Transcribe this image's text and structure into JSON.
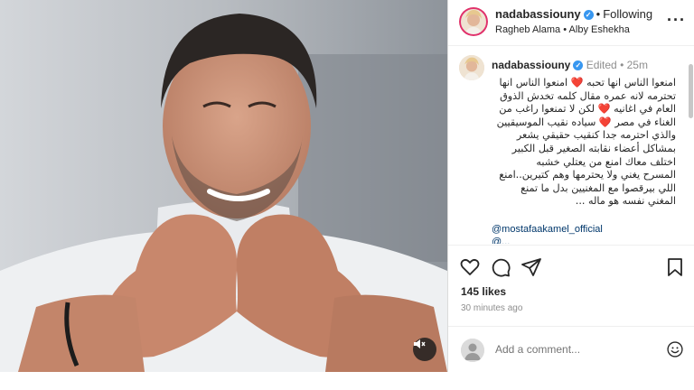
{
  "post": {
    "author": {
      "username": "nadabassiouny",
      "verified": true,
      "follow_status": "Following"
    },
    "audio": {
      "artist": "Ragheb Alama",
      "track": "Alby Eshekha",
      "separator": "•"
    },
    "more_icon": "more-horizontal-icon",
    "caption": {
      "username": "nadabassiouny",
      "edited_label": "Edited",
      "time": "25m",
      "lines": [
        "امنعوا الناس انها تحبه ❤️ امنعوا الناس انها",
        "تحترمه لانه عمره مقال كلمه تخدش الذوق",
        "العام في اغانيه ❤️ لكن لا تمنعوا راغب من",
        "الغناء في مصر ❤️ سياده نقيب الموسيقيين",
        "والذي احترمه جدا كنقيب حقيقي يشعر",
        "بمشاكل أعضاء نقابته الصغير قبل الكبير",
        "اختلف معاك  امنع من يعتلي خشبه",
        "المسرح يغني  ولا يحترمها وهم كتيرين..امنع",
        "اللي بيرقصوا مع المغنيين بدل ما تمنع",
        "المغني نفسه  هو ماله ..."
      ],
      "mention": "@mostafaakamel_official",
      "mention_partial": "@..."
    },
    "actions": {
      "like_icon": "heart-icon",
      "comment_icon": "comment-icon",
      "share_icon": "share-icon",
      "save_icon": "bookmark-icon"
    },
    "likes": "145 likes",
    "time_ago": "30 minutes ago",
    "comment": {
      "placeholder": "Add a comment...",
      "emoji_icon": "emoji-icon"
    },
    "media": {
      "mute_icon": "muted-speaker-icon"
    }
  },
  "colors": {
    "verified": "#3897f0",
    "story_ring": "#e1306c",
    "mention": "#00376b",
    "heart_emoji": "#e0245e"
  }
}
